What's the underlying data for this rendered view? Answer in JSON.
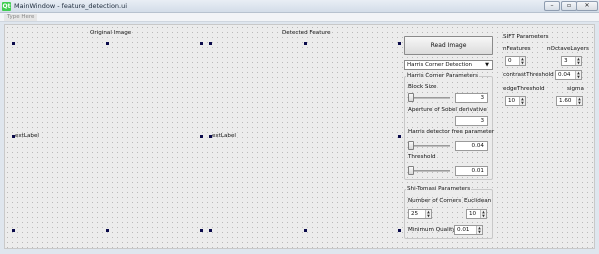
{
  "window": {
    "title": "MainWindow - feature_detection.ui",
    "app_icon_text": "Qt",
    "controls": {
      "minimize": "–",
      "maximize": "▫",
      "close": "✕"
    }
  },
  "menubar": {
    "items": [
      {
        "label": "Type Here"
      }
    ]
  },
  "main": {
    "original_image_label": "Original Image",
    "detected_feature_label": "Detected Feature",
    "image_placeholder_left": "extLabel",
    "image_placeholder_right": "extLabel",
    "read_image_button": "Read Image",
    "detector_combo": {
      "selected": "Harris Corner Detection"
    }
  },
  "harris": {
    "title": "Harris Corner Parameters",
    "block_size": {
      "label": "Block Size",
      "value": "3",
      "slider_fraction": 0.0
    },
    "aperture": {
      "label": "Aperture  of  Sobel derivative",
      "value": "3"
    },
    "free_param": {
      "label": "Harris detector free parameter",
      "value": "0.04",
      "slider_fraction": 0.0
    },
    "threshold": {
      "label": "Threshold",
      "value": "0.01",
      "slider_fraction": 0.0
    }
  },
  "shi_tomasi": {
    "title": "Shi-Tomasi Parameters",
    "num_corners": {
      "label": "Number of Corners",
      "value": "25"
    },
    "euclidean": {
      "label": "Euclidean",
      "value": "10"
    },
    "min_quality": {
      "label": "Minimum Quality",
      "value": "0.01"
    }
  },
  "sift": {
    "title": "SIFT Parameters",
    "nfeatures": {
      "label": "nFeatures",
      "value": "0"
    },
    "noctave_layers": {
      "label": "nOctaveLayers",
      "value": "3"
    },
    "contrast_threshold": {
      "label": "contrastThreshold",
      "value": "0.04"
    },
    "edge_threshold": {
      "label": "edgeThreshold",
      "value": "10"
    },
    "sigma": {
      "label": "sigma",
      "value": "1.60"
    }
  }
}
